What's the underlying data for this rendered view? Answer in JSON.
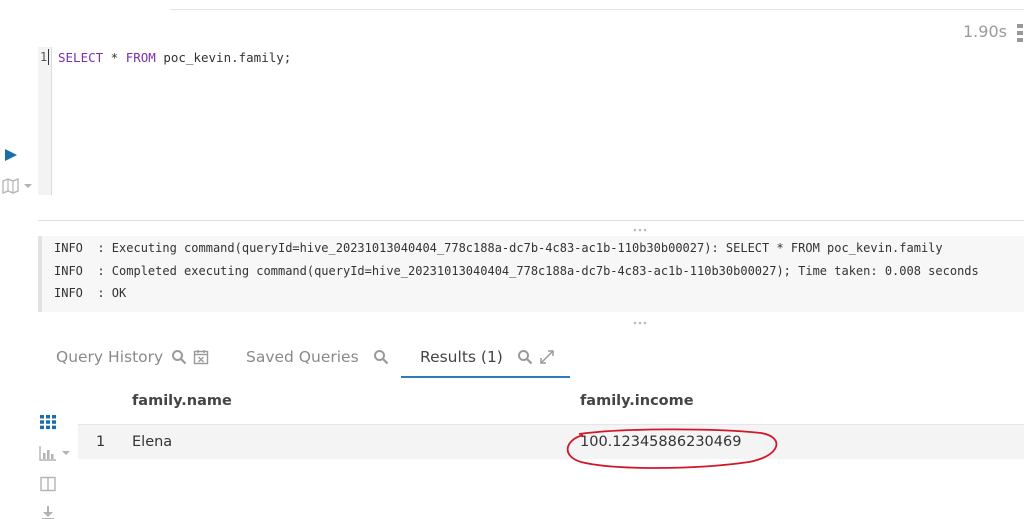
{
  "query_timing": "1.90s",
  "editor": {
    "line_number": "1",
    "sql": {
      "kw_select": "SELECT",
      "star": " * ",
      "kw_from": "FROM",
      "table": " poc_kevin.family;"
    }
  },
  "log": {
    "lines": [
      "INFO  : Executing command(queryId=hive_20231013040404_778c188a-dc7b-4c83-ac1b-110b30b00027): SELECT * FROM poc_kevin.family",
      "INFO  : Completed executing command(queryId=hive_20231013040404_778c188a-dc7b-4c83-ac1b-110b30b00027); Time taken: 0.008 seconds",
      "INFO  : OK"
    ]
  },
  "tabs": {
    "query_history": "Query History",
    "saved_queries": "Saved Queries",
    "results": "Results (1)"
  },
  "results": {
    "columns": [
      "family.name",
      "family.income"
    ],
    "rows": [
      {
        "index": "1",
        "name": "Elena",
        "income": "100.12345886230469"
      }
    ]
  },
  "colors": {
    "accent": "#2b7bbd",
    "keyword": "#7b30a8",
    "annotation": "#d0182a"
  },
  "icons": [
    "play-icon",
    "map-icon",
    "search-icon",
    "calendar-clear-icon",
    "expand-icon",
    "grid-icon",
    "bar-chart-icon",
    "columns-icon",
    "download-icon"
  ]
}
